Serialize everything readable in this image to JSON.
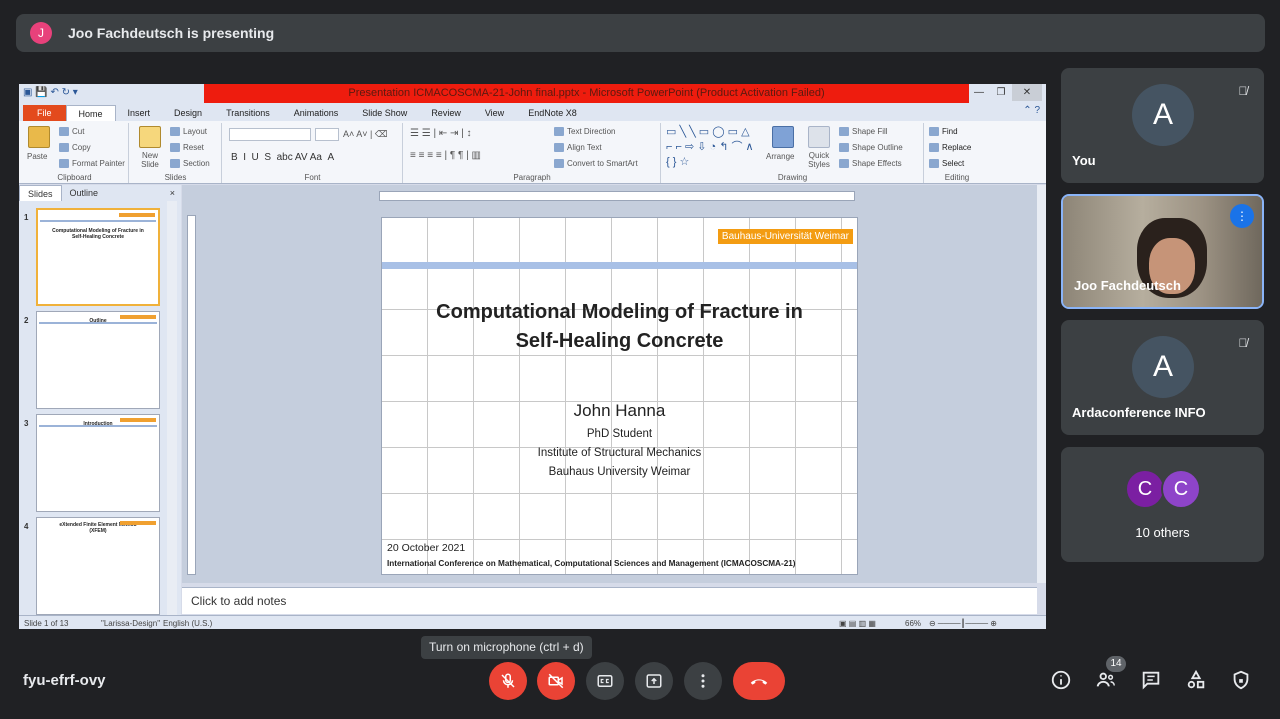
{
  "presenter_bar": {
    "avatar_letter": "J",
    "text": "Joo Fachdeutsch is presenting"
  },
  "ppt": {
    "window_title": "Presentation ICMACOSCMA-21-John final.pptx - Microsoft PowerPoint (Product Activation Failed)",
    "tabs": [
      "File",
      "Home",
      "Insert",
      "Design",
      "Transitions",
      "Animations",
      "Slide Show",
      "Review",
      "View",
      "EndNote X8"
    ],
    "ribbon": {
      "clipboard": {
        "label": "Clipboard",
        "paste": "Paste",
        "cut": "Cut",
        "copy": "Copy",
        "format_painter": "Format Painter"
      },
      "slides": {
        "label": "Slides",
        "new_slide": "New Slide",
        "layout": "Layout",
        "reset": "Reset",
        "section": "Section"
      },
      "font": {
        "label": "Font"
      },
      "paragraph": {
        "label": "Paragraph",
        "text_direction": "Text Direction",
        "align_text": "Align Text",
        "convert_smartart": "Convert to SmartArt"
      },
      "drawing": {
        "label": "Drawing",
        "arrange": "Arrange",
        "quick_styles": "Quick Styles",
        "shape_fill": "Shape Fill",
        "shape_outline": "Shape Outline",
        "shape_effects": "Shape Effects"
      },
      "editing": {
        "label": "Editing",
        "find": "Find",
        "replace": "Replace",
        "select": "Select"
      }
    },
    "panel": {
      "tab_slides": "Slides",
      "tab_outline": "Outline",
      "close": "×"
    },
    "thumbs": [
      {
        "num": "1",
        "title": "Computational Modeling of Fracture in Self-Healing Concrete"
      },
      {
        "num": "2",
        "title": "Outline"
      },
      {
        "num": "3",
        "title": "Introduction"
      },
      {
        "num": "4",
        "title": "eXtended Finite Element Method (XFEM)"
      }
    ],
    "slide": {
      "badge": "Bauhaus-Universität Weimar",
      "title_line1": "Computational Modeling of Fracture in",
      "title_line2": "Self-Healing Concrete",
      "author": "John Hanna",
      "line1": "PhD Student",
      "line2": "Institute of Structural Mechanics",
      "line3": "Bauhaus University Weimar",
      "date": "20 October 2021",
      "conference": "International Conference on Mathematical, Computational Sciences and Management (ICMACOSCMA-21)"
    },
    "notes_placeholder": "Click to add notes",
    "status": {
      "slide": "Slide 1 of 13",
      "theme": "\"Larissa-Design\"",
      "lang": "English (U.S.)",
      "zoom": "66%"
    }
  },
  "participants": [
    {
      "name": "You",
      "avatar": "A"
    },
    {
      "name": "Joo Fachdeutsch"
    },
    {
      "name": "Ardaconference INFO",
      "avatar": "A"
    },
    {
      "name": "10 others",
      "avatars": [
        "C",
        "C"
      ]
    }
  ],
  "tooltip": "Turn on microphone (ctrl + d)",
  "meeting_code": "fyu-efrf-ovy",
  "people_count": "14",
  "colors": {
    "bg": "#202124",
    "tile": "#3c4043",
    "red": "#ea4335",
    "blue": "#1a73e8",
    "purple": "#7b1fa2"
  }
}
